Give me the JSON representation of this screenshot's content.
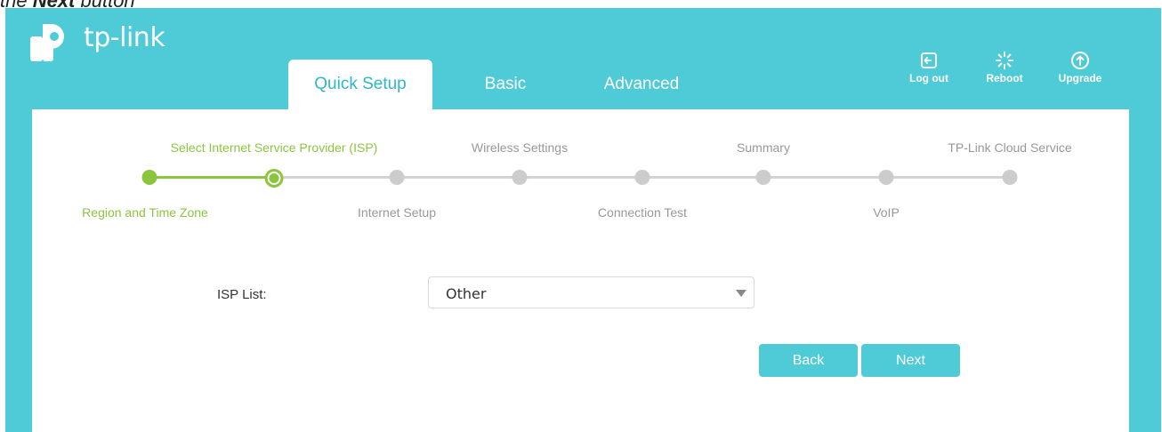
{
  "caption": {
    "prefix": "the ",
    "bold": "Next",
    "suffix": " button"
  },
  "brand": {
    "name": "tp-link",
    "color": "#4ecbd6",
    "accent": "#8cc63f"
  },
  "tabs": [
    {
      "label": "Quick Setup",
      "active": true
    },
    {
      "label": "Basic",
      "active": false
    },
    {
      "label": "Advanced",
      "active": false
    }
  ],
  "toolbar": {
    "logout": {
      "label": "Log out",
      "icon": "logout-icon"
    },
    "reboot": {
      "label": "Reboot",
      "icon": "reboot-icon"
    },
    "upgrade": {
      "label": "Upgrade",
      "icon": "upgrade-icon"
    }
  },
  "steps": [
    {
      "label": "Region and Time Zone",
      "status": "done"
    },
    {
      "label": "Select Internet Service Provider (ISP)",
      "status": "current"
    },
    {
      "label": "Internet Setup",
      "status": "pending"
    },
    {
      "label": "Wireless Settings",
      "status": "pending"
    },
    {
      "label": "Connection Test",
      "status": "pending"
    },
    {
      "label": "Summary",
      "status": "pending"
    },
    {
      "label": "VoIP",
      "status": "pending"
    },
    {
      "label": "TP-Link Cloud Service",
      "status": "pending"
    }
  ],
  "form": {
    "isp_label": "ISP List:",
    "isp_value": "Other"
  },
  "buttons": {
    "back": "Back",
    "next": "Next"
  }
}
